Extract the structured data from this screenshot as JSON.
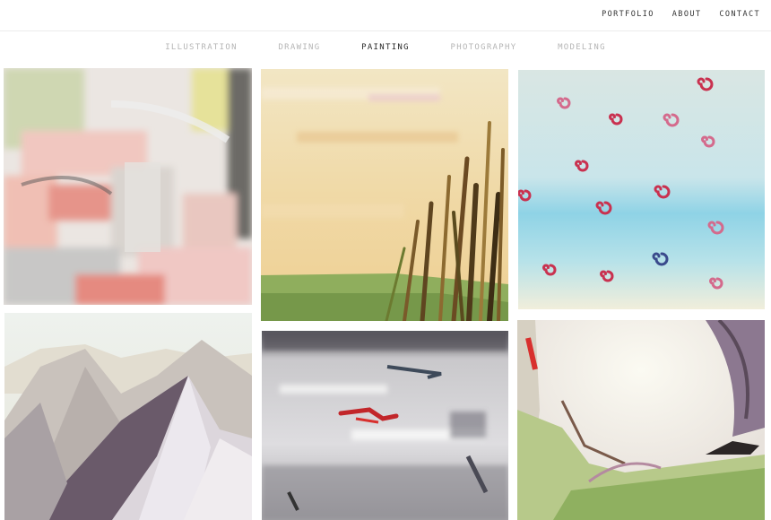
{
  "topnav": {
    "items": [
      {
        "label": "PORTFOLIO"
      },
      {
        "label": "ABOUT"
      },
      {
        "label": "CONTACT"
      }
    ]
  },
  "categories": {
    "items": [
      {
        "label": "ILLUSTRATION",
        "active": false
      },
      {
        "label": "DRAWING",
        "active": false
      },
      {
        "label": "PAINTING",
        "active": true
      },
      {
        "label": "PHOTOGRAPHY",
        "active": false
      },
      {
        "label": "MODELING",
        "active": false
      }
    ]
  },
  "gallery": {
    "items": [
      {
        "subject": "abstract pink and grey landscape painting"
      },
      {
        "subject": "golden sky with tall grass painting"
      },
      {
        "subject": "blue sky with red spirals painting"
      },
      {
        "subject": "purple mountain peaks painting"
      },
      {
        "subject": "grey abstract with red brushstroke painting"
      },
      {
        "subject": "green field with purple sky painting"
      }
    ]
  },
  "colors": {
    "active_category": "#2a2a2a",
    "inactive_category": "#b5b5b5",
    "nav_text": "#333333"
  }
}
